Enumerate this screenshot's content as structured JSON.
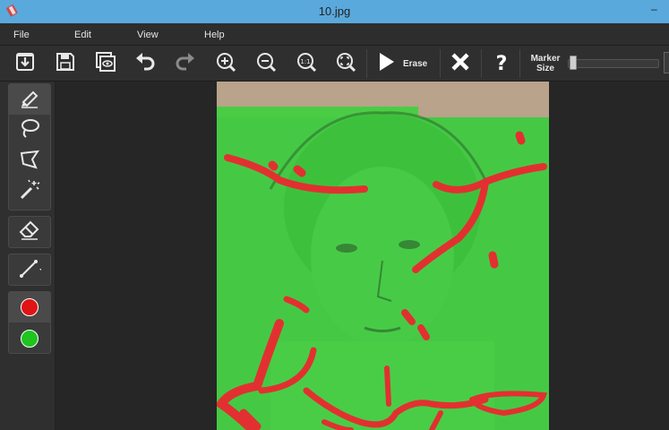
{
  "window": {
    "title": "10.jpg"
  },
  "menu": {
    "items": [
      "File",
      "Edit",
      "View",
      "Help"
    ]
  },
  "toolbar": {
    "erase_label": "Erase",
    "marker_size_label_line1": "Marker",
    "marker_size_label_line2": "Size",
    "marker_size_value": 0.02
  },
  "tools": {
    "colors": {
      "remove": "#e01414",
      "keep": "#1fc41f"
    }
  },
  "icons": {
    "titlebar": "app-icon",
    "toolbar": [
      "open-icon",
      "save-icon",
      "preview-icon",
      "undo-icon",
      "redo-icon",
      "zoom-in-icon",
      "zoom-out-icon",
      "zoom-actual-icon",
      "zoom-fit-icon",
      "play-icon",
      "close-icon",
      "help-icon"
    ],
    "sidebar": [
      "marker-icon",
      "lasso-icon",
      "polygon-lasso-icon",
      "magic-wand-icon",
      "eraser-icon",
      "line-icon",
      "red-color-icon",
      "green-color-icon"
    ]
  },
  "colors": {
    "titlebar": "#5aa9dc",
    "keep_overlay": "#3bd13b",
    "remove_stroke": "#e23030"
  }
}
